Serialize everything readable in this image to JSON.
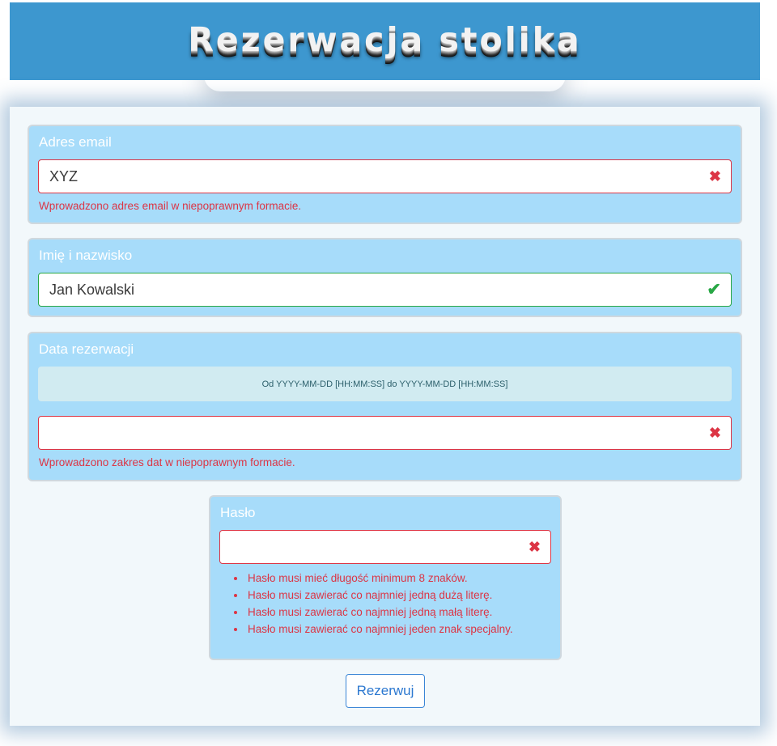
{
  "header": {
    "title": "Rezerwacja stolika"
  },
  "form": {
    "email": {
      "label": "Adres email",
      "value": "XYZ",
      "status": "invalid",
      "error": "Wprowadzono adres email w niepoprawnym formacie."
    },
    "name": {
      "label": "Imię i nazwisko",
      "value": "Jan Kowalski",
      "status": "valid"
    },
    "date": {
      "label": "Data rezerwacji",
      "hint": "Od YYYY-MM-DD [HH:MM:SS] do YYYY-MM-DD [HH:MM:SS]",
      "value": "",
      "status": "invalid",
      "error": "Wprowadzono zakres dat w niepoprawnym formacie."
    },
    "password": {
      "label": "Hasło",
      "value": "",
      "status": "invalid",
      "errors": [
        "Hasło musi mieć długość minimum 8 znaków.",
        "Hasło musi zawierać co najmniej jedną dużą literę.",
        "Hasło musi zawierać co najmniej jedną małą literę.",
        "Hasło musi zawierać co najmniej jeden znak specjalny."
      ]
    },
    "submit_label": "Rezerwuj"
  },
  "icons": {
    "invalid": "✖",
    "valid": "✔"
  },
  "colors": {
    "header_bg": "#3d97cf",
    "group_bg": "#a7dcfa",
    "error": "#dc3545",
    "valid": "#28a745",
    "button": "#2c78d0"
  }
}
